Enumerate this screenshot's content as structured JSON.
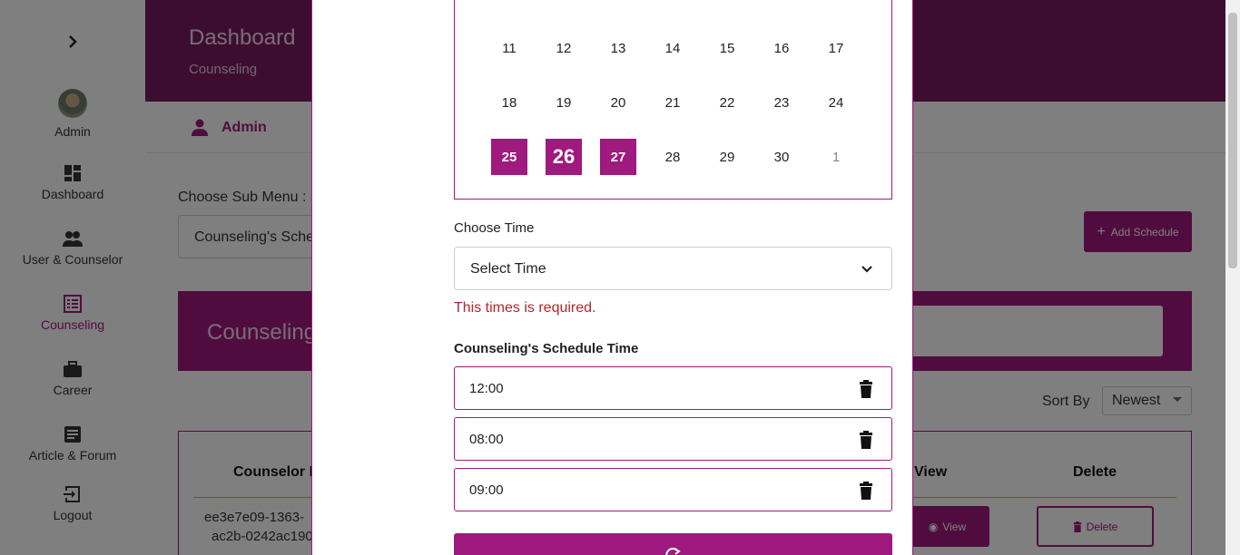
{
  "sidebar": {
    "admin_label": "Admin",
    "items": [
      {
        "label": "Dashboard",
        "icon": "dashboard-icon"
      },
      {
        "label": "User & Counselor",
        "icon": "users-icon"
      },
      {
        "label": "Counseling",
        "icon": "list-icon",
        "active": true
      },
      {
        "label": "Career",
        "icon": "briefcase-icon"
      },
      {
        "label": "Article & Forum",
        "icon": "article-icon"
      },
      {
        "label": "Logout",
        "icon": "logout-icon"
      }
    ]
  },
  "header": {
    "title": "Dashboard",
    "subtitle": "Counseling"
  },
  "userbar": {
    "name": "Admin"
  },
  "main": {
    "sub_menu_label": "Choose Sub Menu :",
    "sub_menu_value": "Counseling's Schedule",
    "add_button": "Add Schedule",
    "banner_title": "Counseling's Schedule",
    "sort_label": "Sort By",
    "sort_value": "Newest",
    "table": {
      "headers": {
        "counselor_id": "Counselor Id",
        "view": "View",
        "delete": "Delete"
      },
      "row": {
        "id_line1": "ee3e7e09-1363-",
        "id_line2": "ac2b-0242ac190",
        "view_button": "View",
        "delete_button": "Delete"
      }
    }
  },
  "modal": {
    "calendar": {
      "weeks": [
        [
          "11",
          "12",
          "13",
          "14",
          "15",
          "16",
          "17"
        ],
        [
          "18",
          "19",
          "20",
          "21",
          "22",
          "23",
          "24"
        ],
        [
          "25",
          "26",
          "27",
          "28",
          "29",
          "30",
          "1"
        ]
      ],
      "selected": [
        "25",
        "26",
        "27"
      ]
    },
    "choose_time_label": "Choose Time",
    "time_placeholder": "Select Time",
    "error": "This times is required.",
    "schedule_label": "Counseling's Schedule Time",
    "slots": [
      "12:00",
      "08:00",
      "09:00"
    ]
  },
  "colors": {
    "accent": "#a0197e",
    "header": "#7a1b63",
    "error": "#b3262e"
  }
}
